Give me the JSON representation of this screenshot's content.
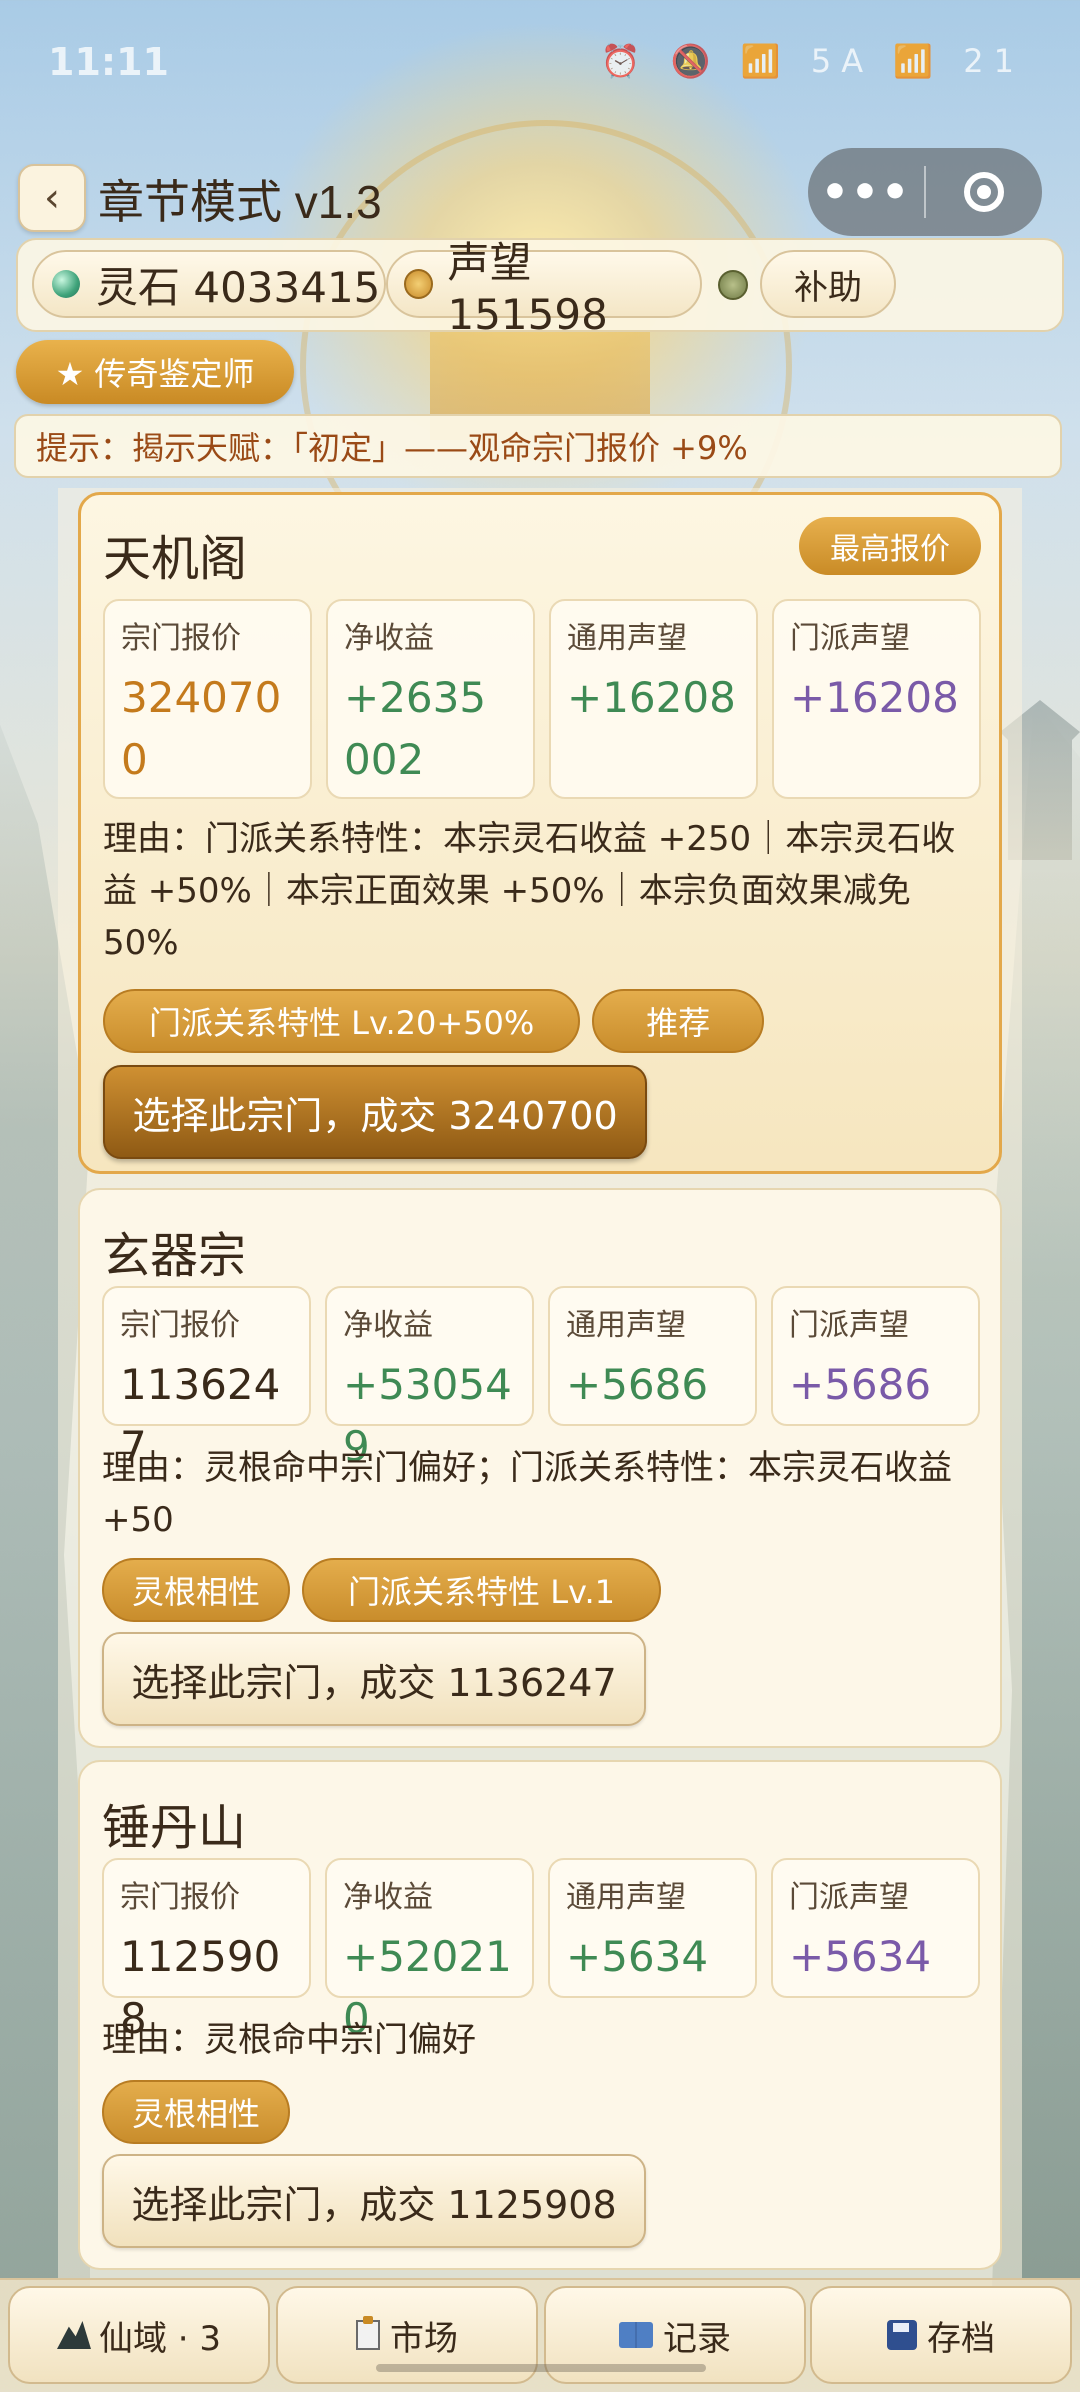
{
  "status_bar": {
    "time": "11:11",
    "icons": "⏰ 🔕 📶 5A 📶 21"
  },
  "header": {
    "back_label": "‹",
    "title": "章节模式 v1.3",
    "more_label": "•••"
  },
  "resources": {
    "spirit_stone": "灵石 4033415",
    "reputation": "声望 151598",
    "aid_label": "补助"
  },
  "badge": {
    "label": "★ 传奇鉴定师"
  },
  "hint": {
    "text": "提示：揭示天赋：「初定」——观命宗门报价 +9%"
  },
  "stat_labels": {
    "offer": "宗门报价",
    "net": "净收益",
    "general_fame": "通用声望",
    "sect_fame": "门派声望"
  },
  "cards": [
    {
      "name": "天机阁",
      "best_tag": "最高报价",
      "offer": "3240700",
      "net": "+2635002",
      "general_fame": "+16208",
      "sect_fame": "+16208",
      "reason": "理由：门派关系特性：本宗灵石收益 +250｜本宗灵石收益 +50%｜本宗正面效果 +50%｜本宗负面效果减免 50%",
      "tags": [
        "门派关系特性 Lv.20+50%",
        "推荐"
      ],
      "select_label": "选择此宗门，成交 3240700"
    },
    {
      "name": "玄器宗",
      "offer": "1136247",
      "net": "+530549",
      "general_fame": "+5686",
      "sect_fame": "+5686",
      "reason": "理由：灵根命中宗门偏好；门派关系特性：本宗灵石收益 +50",
      "tags": [
        "灵根相性",
        "门派关系特性 Lv.1"
      ],
      "select_label": "选择此宗门，成交 1136247"
    },
    {
      "name": "锤丹山",
      "offer": "1125908",
      "net": "+520210",
      "general_fame": "+5634",
      "sect_fame": "+5634",
      "reason": "理由：灵根命中宗门偏好",
      "tags": [
        "灵根相性"
      ],
      "select_label": "选择此宗门，成交 1125908"
    }
  ],
  "bottom_nav": {
    "realm": "仙域 · 3",
    "market": "市场",
    "records": "记录",
    "save": "存档"
  },
  "colors": {
    "accent_gold": "#c98a24",
    "value_green": "#3f8a54",
    "value_purple": "#7a5aa8",
    "hint_text": "#9a4a16"
  }
}
